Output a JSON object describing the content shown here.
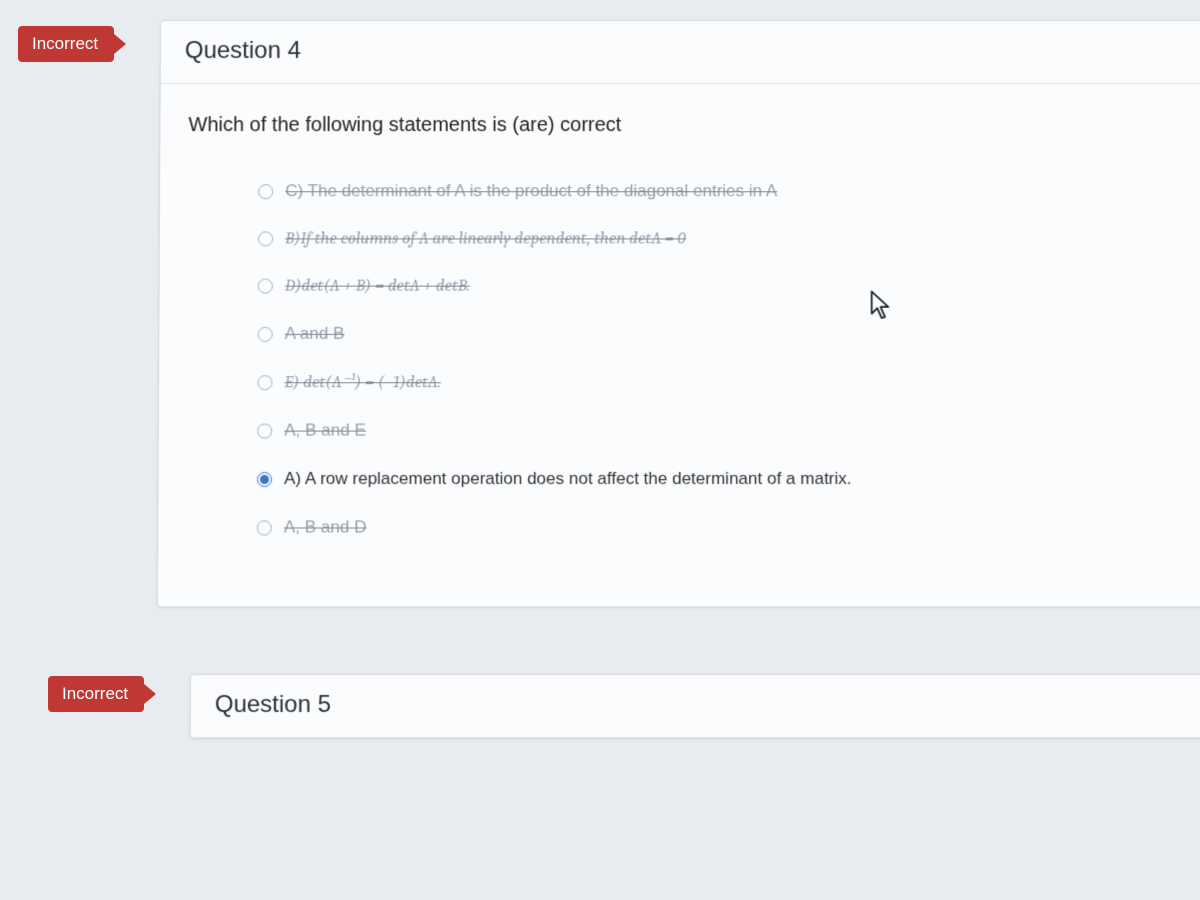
{
  "q4": {
    "badge": "Incorrect",
    "title": "Question 4",
    "prompt": "Which of the following statements is (are) correct",
    "options": {
      "c": "C) The determinant of A is the product of the diagonal entries in A",
      "b": "B)If the columns of A are linearly dependent, then detA = 0",
      "d": "D)det(A + B) = detA + detB.",
      "ab": "A and B",
      "e": "E) det(A⁻¹) = (−1)detA.",
      "abe": "A, B and E",
      "a": "A) A row replacement operation does not affect the determinant of a matrix.",
      "abd": "A, B and D"
    }
  },
  "q5": {
    "badge": "Incorrect",
    "title": "Question 5"
  }
}
